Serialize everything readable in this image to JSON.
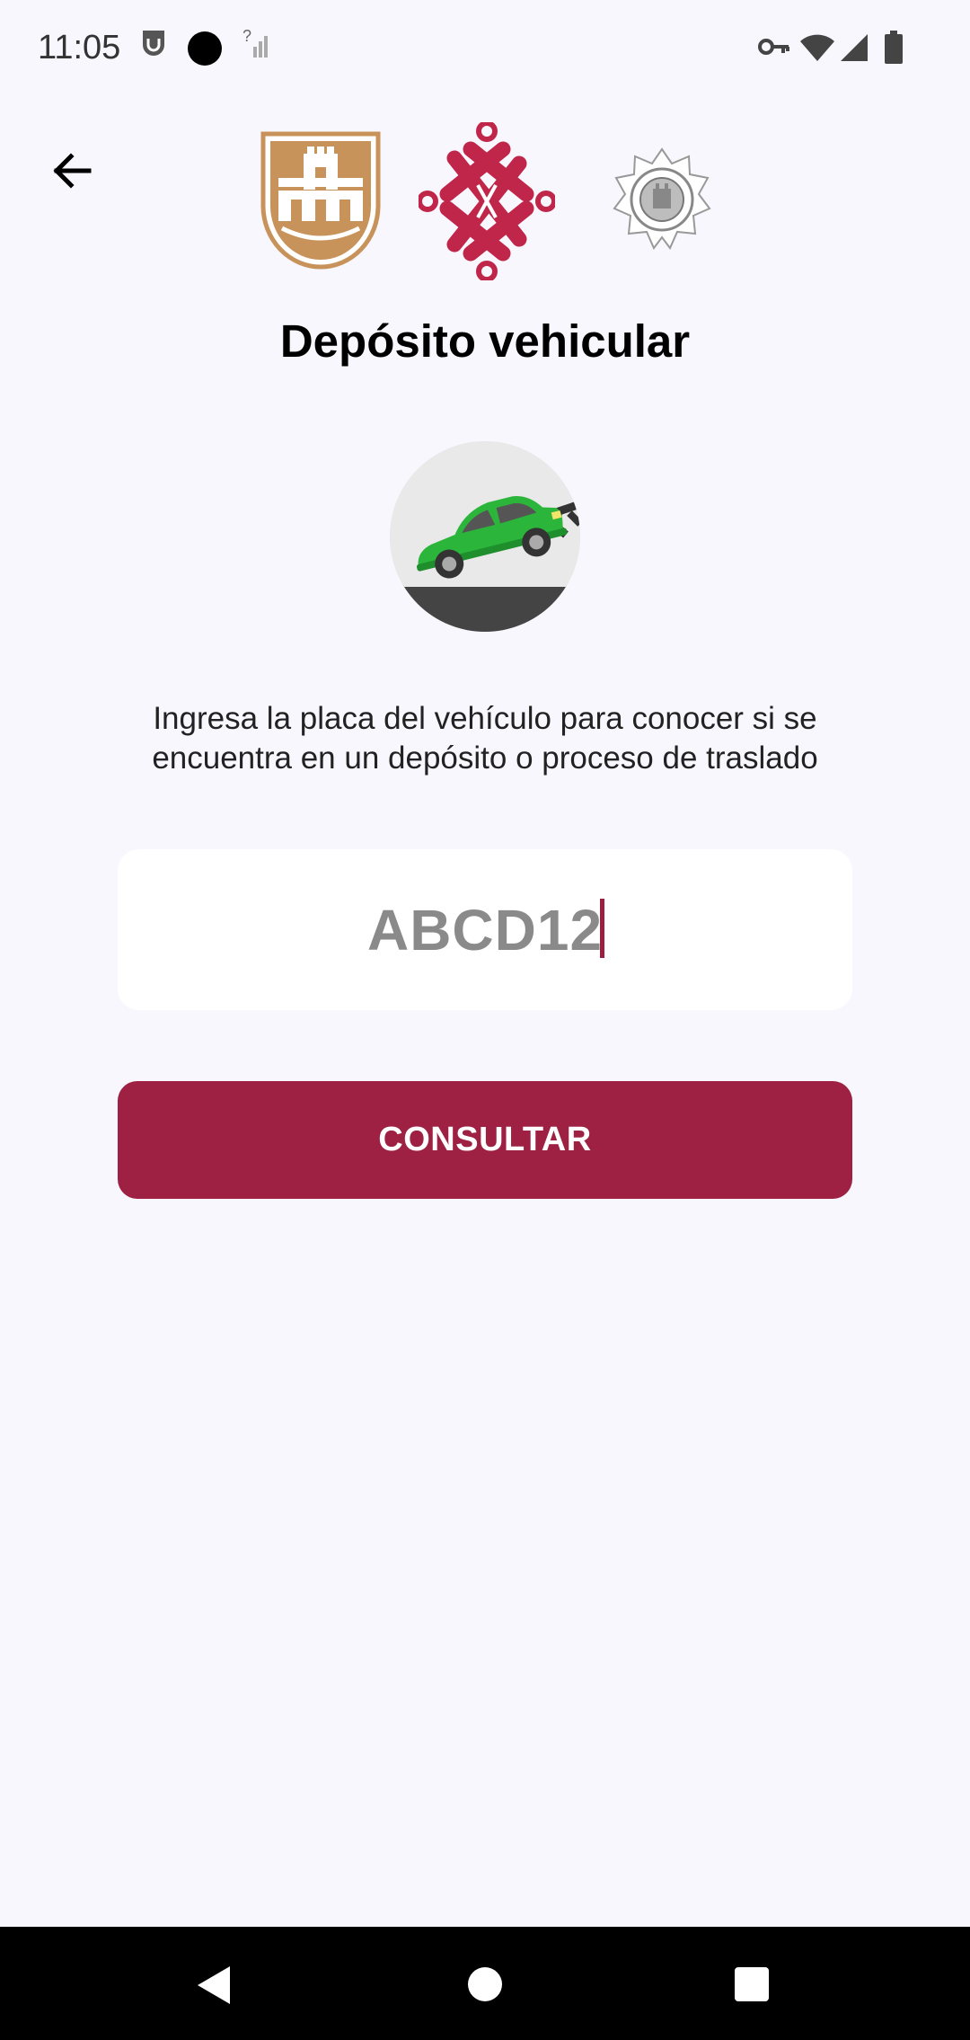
{
  "status_bar": {
    "time": "11:05",
    "icons_left": [
      "mail-badge-icon",
      "record-dot-icon",
      "no-signal-icon"
    ],
    "icons_right": [
      "vpn-key-icon",
      "wifi-icon",
      "cell-signal-icon",
      "battery-icon"
    ]
  },
  "header": {
    "back_icon": "arrow-left-icon",
    "logos": [
      "cdmx-shield-logo",
      "government-knot-logo",
      "police-badge-logo"
    ]
  },
  "page": {
    "title": "Depósito vehicular",
    "hero_icon": "tow-car-icon",
    "instructions": "Ingresa la placa del vehículo para conocer si se encuentra en un depósito o proceso de traslado"
  },
  "form": {
    "plate_placeholder": "ABCD12",
    "plate_value": "",
    "submit_label": "CONSULTAR"
  },
  "nav_bar": {
    "items": [
      "back-triangle-icon",
      "home-circle-icon",
      "recents-square-icon"
    ]
  },
  "colors": {
    "brand": "#9e2042",
    "gold": "#c8935a",
    "background": "#f7f7fd"
  }
}
